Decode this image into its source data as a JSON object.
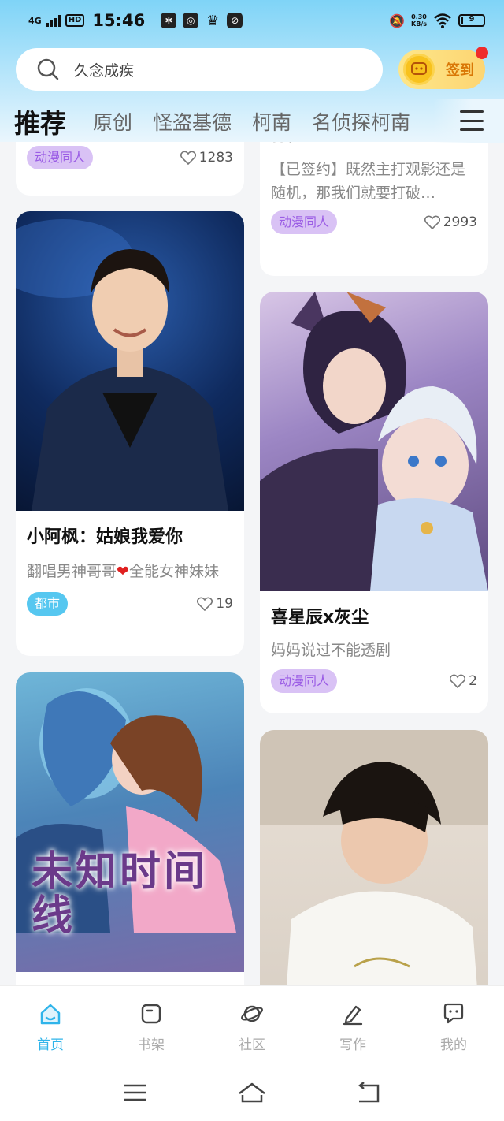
{
  "status_bar": {
    "network": "4G",
    "hd": "HD",
    "time": "15:46",
    "speed_value": "0.30",
    "speed_unit": "KB/s",
    "battery": "9"
  },
  "search": {
    "placeholder": "久念成疾"
  },
  "checkin": {
    "label": "签到"
  },
  "tabs": [
    {
      "label": "推荐",
      "active": true
    },
    {
      "label": "原创"
    },
    {
      "label": "怪盗基德"
    },
    {
      "label": "柯南"
    },
    {
      "label": "名侦探柯南"
    }
  ],
  "cards": {
    "left_top": {
      "tag": "动漫同人",
      "likes": "1283"
    },
    "right_top": {
      "title_tail": "体）",
      "desc": "【已签约】既然主打观影还是随机，那我们就要打破…",
      "tag": "动漫同人",
      "likes": "2993"
    },
    "left_mid": {
      "title": "小阿枫：姑娘我爱你",
      "desc_part1": "翻唱男神哥哥",
      "desc_part2": "全能女神妹妹",
      "tag": "都市",
      "likes": "19"
    },
    "right_mid": {
      "title": "喜星辰x灰尘",
      "desc": "妈妈说过不能透剧",
      "tag": "动漫同人",
      "likes": "2"
    },
    "left_bottom": {
      "cover_text": "未知时间线"
    }
  },
  "bottom_nav": [
    {
      "label": "首页",
      "icon": "home-icon",
      "active": true
    },
    {
      "label": "书架",
      "icon": "bookshelf-icon"
    },
    {
      "label": "社区",
      "icon": "planet-icon"
    },
    {
      "label": "写作",
      "icon": "pen-icon"
    },
    {
      "label": "我的",
      "icon": "chat-icon"
    }
  ],
  "colors": {
    "accent": "#2fb4ea",
    "tag_purple": "#9b5de5",
    "tag_blue": "#56c7f0"
  }
}
